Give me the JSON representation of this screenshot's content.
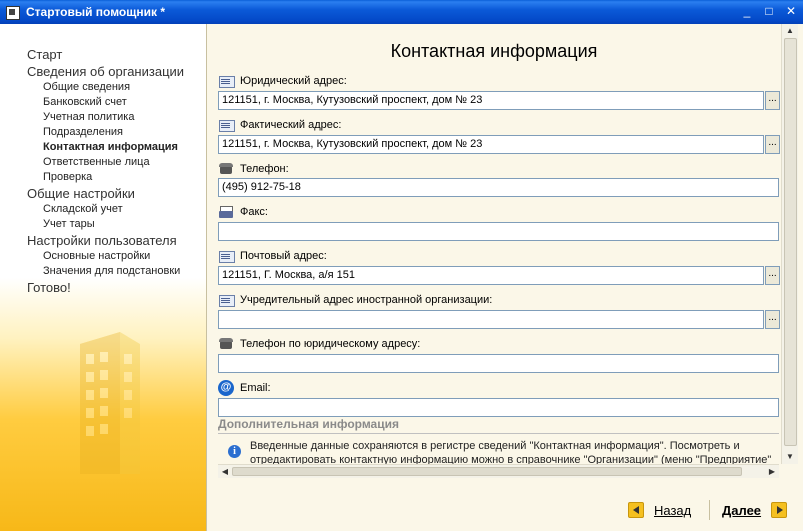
{
  "window": {
    "title": "Стартовый помощник *",
    "minimize_glyph": "_",
    "maximize_glyph": "□",
    "close_glyph": "✕"
  },
  "sidebar": {
    "items": [
      {
        "label": "Старт",
        "level": 0
      },
      {
        "label": "Сведения об организации",
        "level": 0
      },
      {
        "label": "Общие сведения",
        "level": 1
      },
      {
        "label": "Банковский счет",
        "level": 1
      },
      {
        "label": "Учетная политика",
        "level": 1
      },
      {
        "label": "Подразделения",
        "level": 1
      },
      {
        "label": "Контактная информация",
        "level": 1,
        "active": true
      },
      {
        "label": "Ответственные лица",
        "level": 1
      },
      {
        "label": "Проверка",
        "level": 1
      },
      {
        "label": "Общие настройки",
        "level": 0
      },
      {
        "label": "Складской учет",
        "level": 1
      },
      {
        "label": "Учет тары",
        "level": 1
      },
      {
        "label": "Настройки пользователя",
        "level": 0
      },
      {
        "label": "Основные настройки",
        "level": 1
      },
      {
        "label": "Значения для подстановки",
        "level": 1
      },
      {
        "label": "Готово!",
        "level": 0
      }
    ]
  },
  "main": {
    "title": "Контактная информация",
    "fields": {
      "legal_address": {
        "label": "Юридический адрес:",
        "value": "121151, г. Москва, Кутузовский проспект, дом № 23",
        "icon": "address-icon"
      },
      "actual_address": {
        "label": "Фактический адрес:",
        "value": "121151, г. Москва, Кутузовский проспект, дом № 23",
        "icon": "address-icon"
      },
      "phone": {
        "label": "Телефон:",
        "value": "(495) 912-75-18",
        "icon": "phone-icon"
      },
      "fax": {
        "label": "Факс:",
        "value": "",
        "icon": "fax-icon"
      },
      "postal_address": {
        "label": "Почтовый адрес:",
        "value": "121151, Г. Москва, а/я 151",
        "icon": "address-icon"
      },
      "foreign_address": {
        "label": "Учредительный адрес иностранной организации:",
        "value": "",
        "icon": "address-icon"
      },
      "legal_phone": {
        "label": "Телефон по юридическому адресу:",
        "value": "",
        "icon": "phone-icon"
      },
      "email": {
        "label": "Email:",
        "value": "",
        "icon": "email-icon",
        "glyph": "@"
      }
    },
    "select_button_label": "...",
    "additional_section": "Дополнительная информация",
    "info_lines": [
      "Введенные данные сохраняются в регистре сведений \"Контактная информация\". Посмотреть и",
      "отредактировать контактную информацию можно в справочнике \"Организации\" (меню \"Предприятие\""
    ],
    "info_glyph": "i"
  },
  "footer": {
    "back_label": "Назад",
    "next_label": "Далее"
  },
  "colors": {
    "titlebar": "#0449c8",
    "accent_yellow": "#f5c020",
    "form_bg": "#fbf7e8"
  }
}
